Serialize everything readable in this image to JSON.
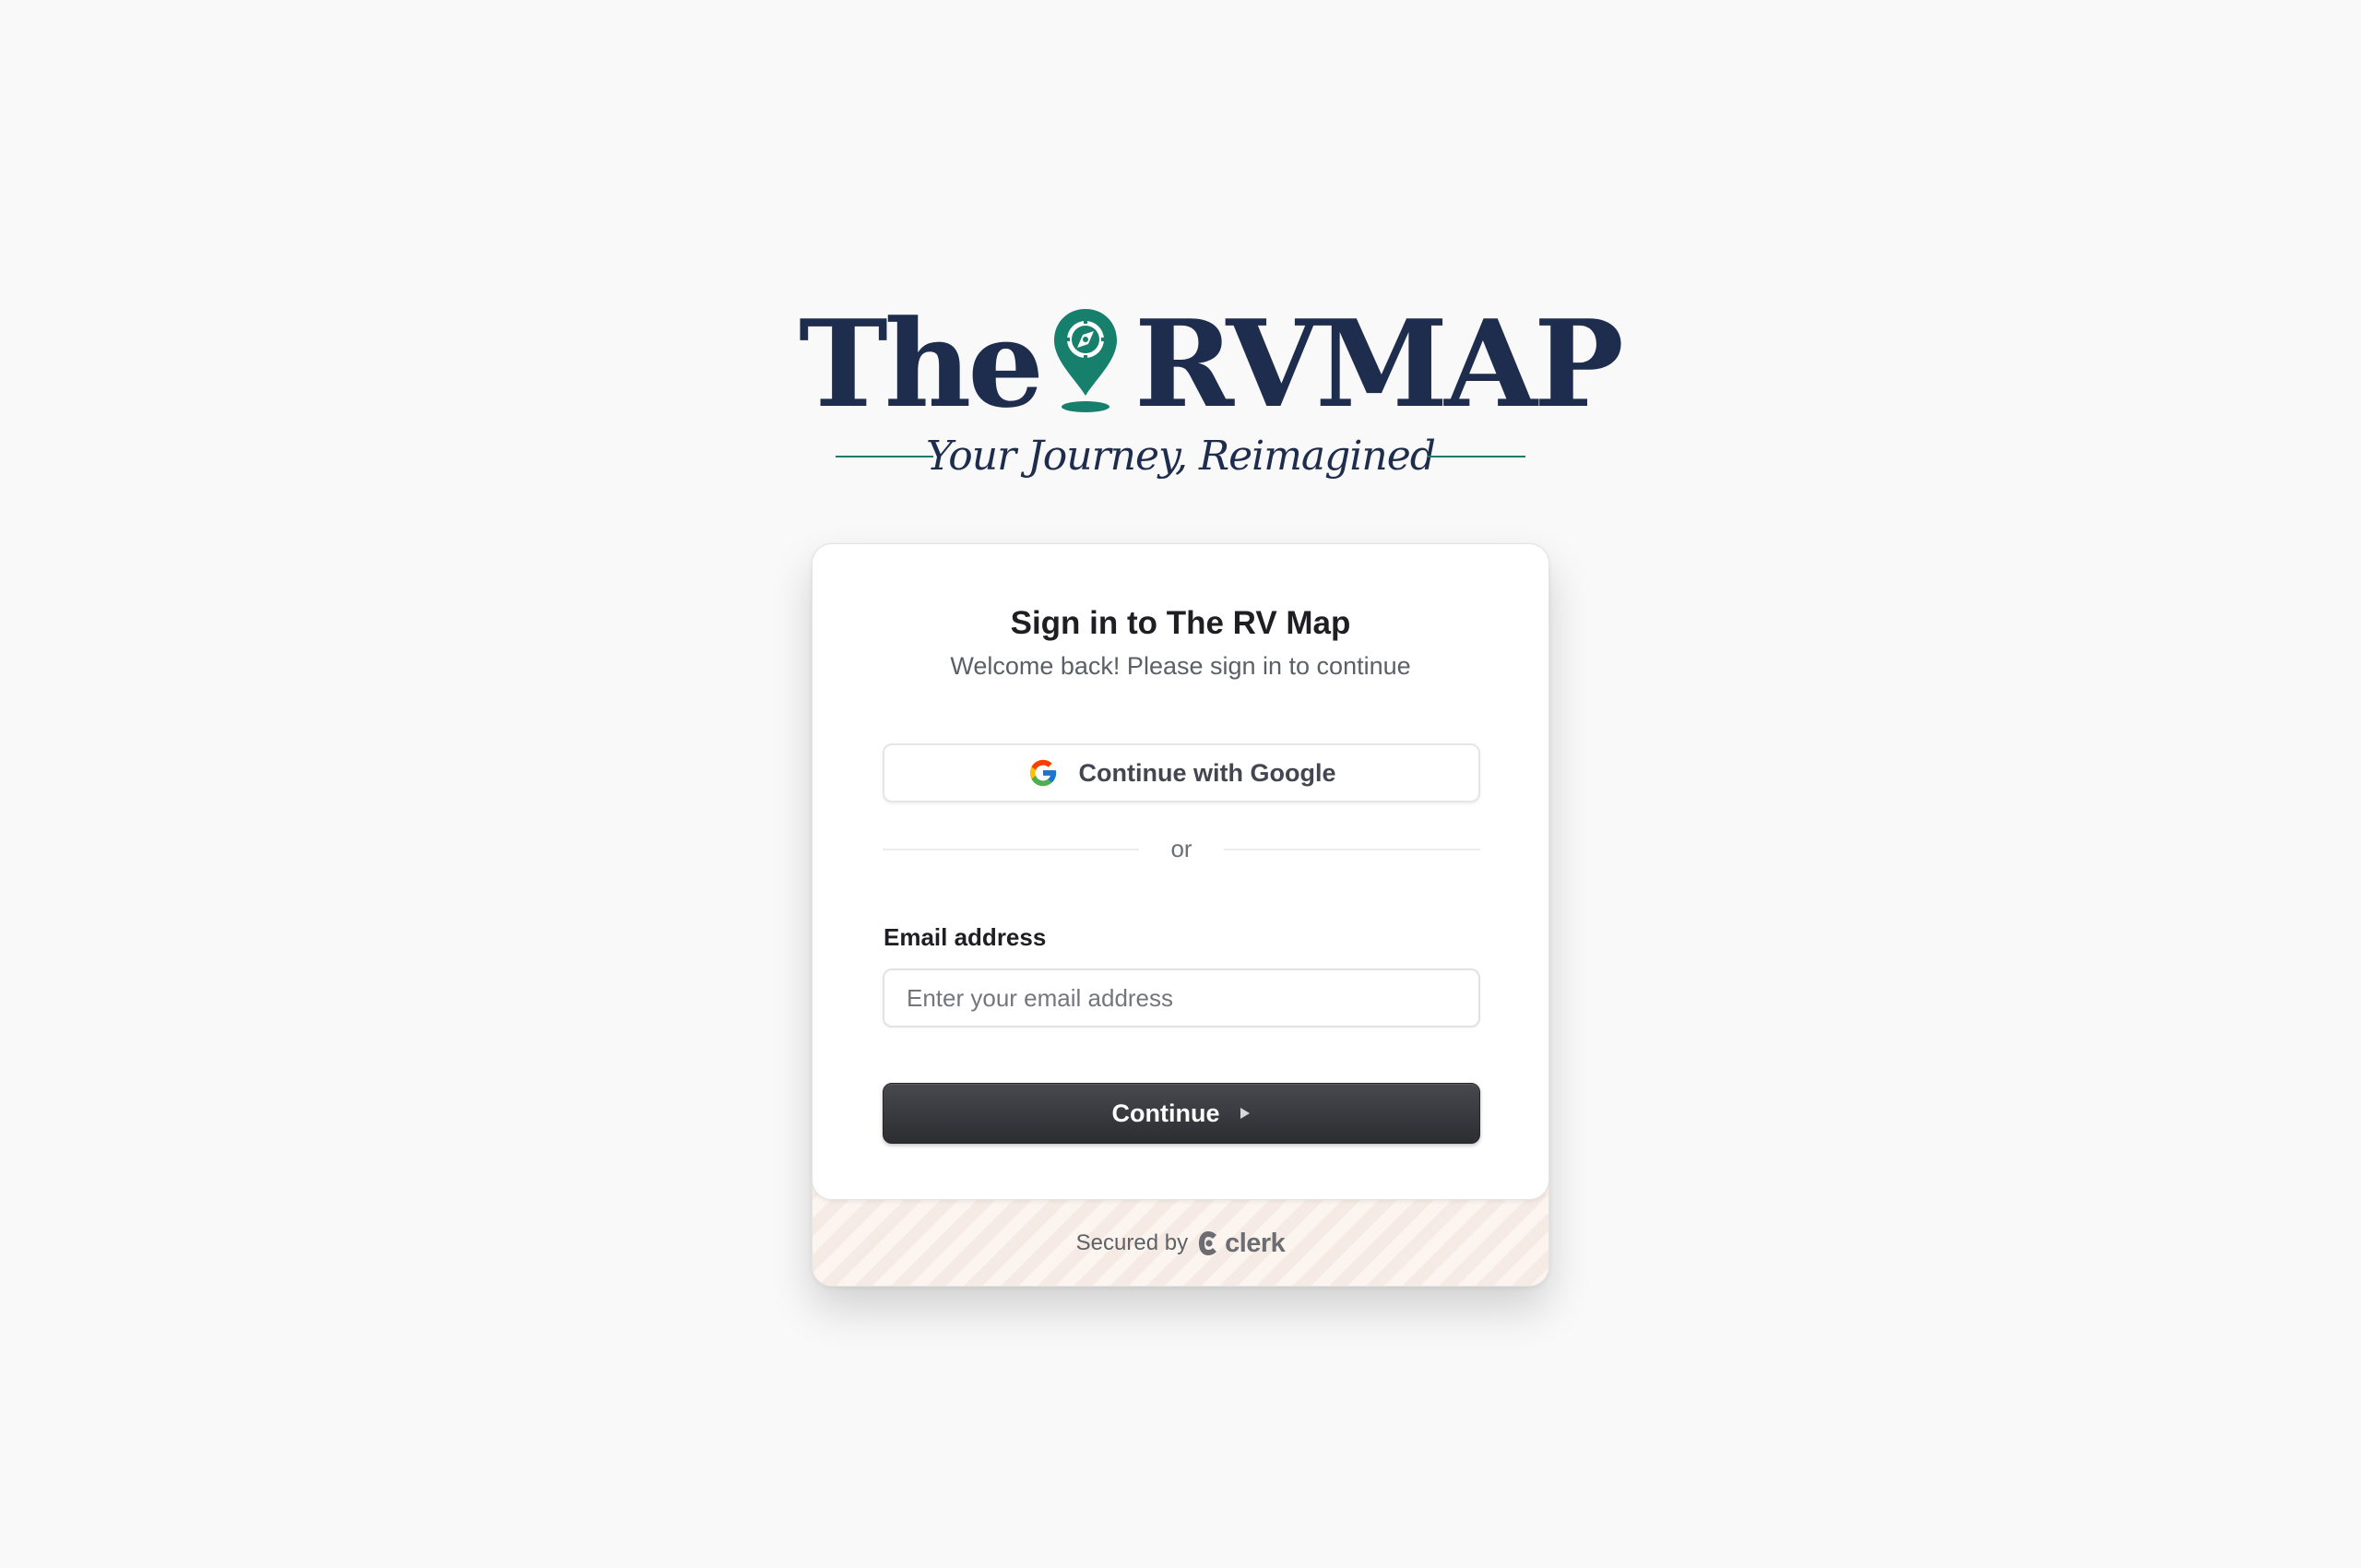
{
  "logo": {
    "word_left": "The",
    "word_right": "RVMAP",
    "tagline": "Your Journey, Reimagined",
    "pin_icon": "map-pin-compass-icon",
    "colors": {
      "navy": "#1e2d4d",
      "teal": "#1f7a6a"
    }
  },
  "card": {
    "title": "Sign in to The RV Map",
    "subtitle": "Welcome back! Please sign in to continue",
    "google_button": {
      "label": "Continue with Google",
      "icon": "google-icon"
    },
    "divider_text": "or",
    "email": {
      "label": "Email address",
      "placeholder": "Enter your email address",
      "value": ""
    },
    "continue_button": {
      "label": "Continue",
      "icon": "triangle-right-icon"
    },
    "footer": {
      "secured_text": "Secured by",
      "brand": "clerk",
      "brand_icon": "clerk-icon"
    }
  }
}
